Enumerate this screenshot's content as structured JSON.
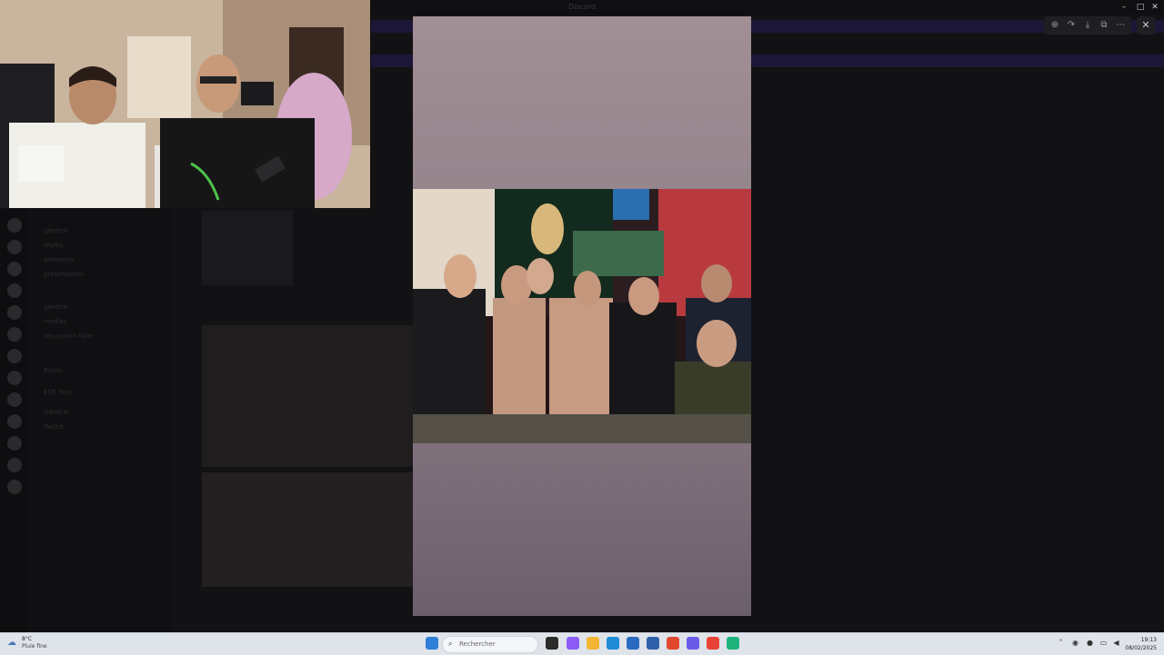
{
  "window": {
    "title": "Discord"
  },
  "sidebar": {
    "channels": [
      "général",
      "règles",
      "annonces",
      "présentation",
      "général",
      "médias",
      "discussion libre",
      "Radio",
      "ECR Tour",
      "Général",
      "Twitch"
    ]
  },
  "viewer": {
    "toolbar_icons": [
      "zoom-in-icon",
      "forward-icon",
      "download-icon",
      "open-external-icon",
      "more-icon"
    ],
    "close_label": "✕"
  },
  "taskbar": {
    "weather_temp": "8°C",
    "weather_desc": "Pluie fine",
    "search_placeholder": "Rechercher",
    "time": "19:13",
    "date": "08/02/2025"
  }
}
